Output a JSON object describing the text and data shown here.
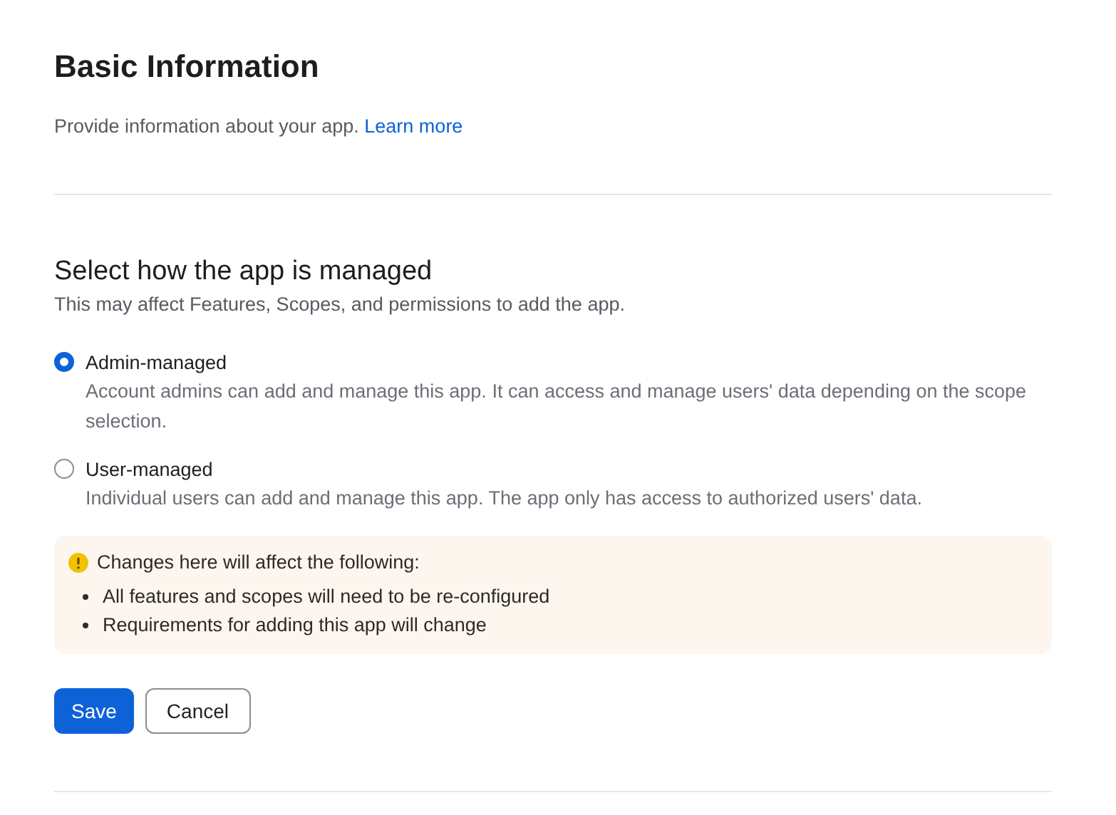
{
  "header": {
    "title": "Basic Information",
    "subtitle": "Provide information about your app.",
    "link": "Learn more"
  },
  "section": {
    "title": "Select how the app is managed",
    "subtitle": "This may affect Features, Scopes, and permissions to add the app."
  },
  "options": [
    {
      "label": "Admin-managed",
      "description": "Account admins can add and manage this app. It can access and manage users' data depending on the scope selection.",
      "selected": true
    },
    {
      "label": "User-managed",
      "description": "Individual users can add and manage this app. The app only has access to authorized users' data.",
      "selected": false
    }
  ],
  "notice": {
    "title": "Changes here will affect the following:",
    "items": [
      "All features and scopes will need to be re-configured",
      "Requirements for adding this app will change"
    ]
  },
  "buttons": [
    {
      "label": "Save",
      "kind": "primary"
    },
    {
      "label": "Cancel",
      "kind": "secondary"
    }
  ]
}
